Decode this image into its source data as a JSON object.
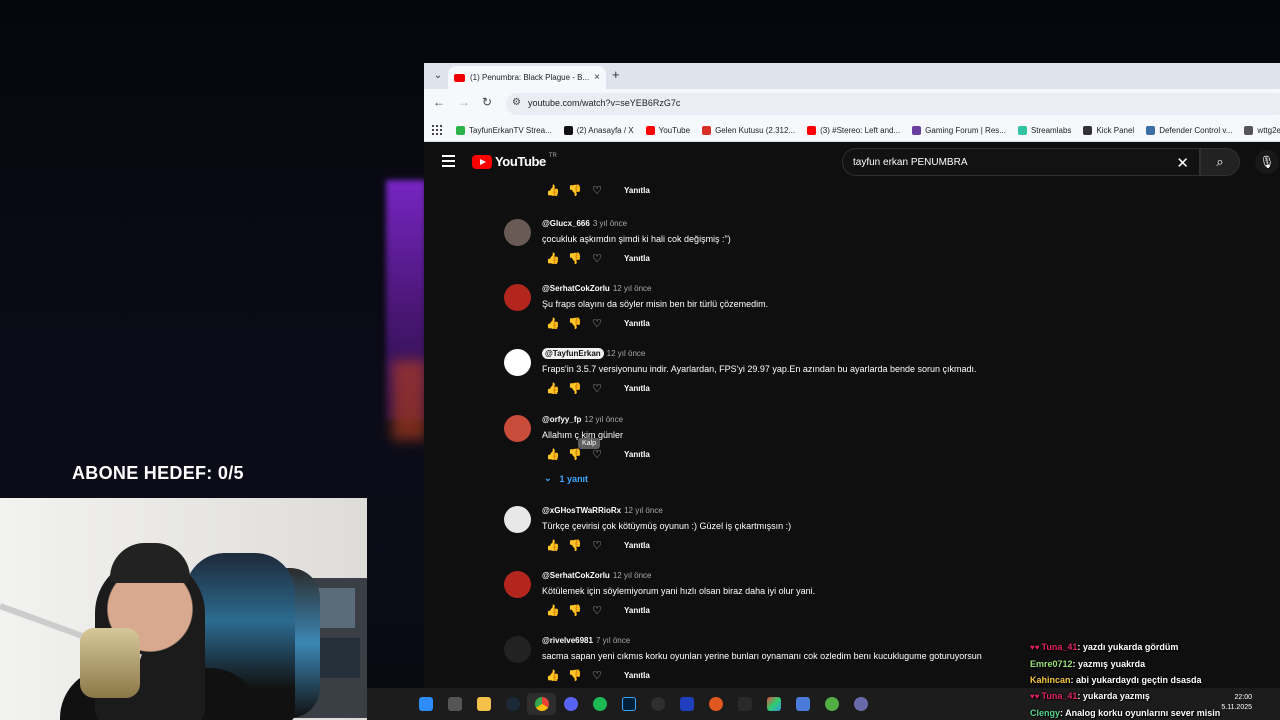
{
  "overlay": {
    "sub_goal": "ABONE HEDEF: 0/5"
  },
  "browser": {
    "tab_title": "(1) Penumbra: Black Plague - B...",
    "tab_close": "×",
    "new_tab": "+",
    "url": "youtube.com/watch?v=seYEB6RzG7c",
    "bookmarks": [
      {
        "label": "TayfunErkanTV Strea...",
        "color": "#2cb34a"
      },
      {
        "label": "(2) Anasayfa / X",
        "color": "#111111"
      },
      {
        "label": "YouTube",
        "color": "#ff0000"
      },
      {
        "label": "Gelen Kutusu (2.312...",
        "color": "#d93025"
      },
      {
        "label": "(3) #Stereo: Left and...",
        "color": "#ff0000"
      },
      {
        "label": "Gaming Forum | Res...",
        "color": "#6b3fa0"
      },
      {
        "label": "Streamlabs",
        "color": "#31c3a2"
      },
      {
        "label": "Kick Panel",
        "color": "#333333"
      },
      {
        "label": "Defender Control v...",
        "color": "#3a6ea5"
      },
      {
        "label": "wttg2e",
        "color": "#555555"
      }
    ]
  },
  "youtube": {
    "logo_text": "YouTube",
    "region": "TR",
    "search_query": "tayfun erkan PENUMBRA",
    "reply_label": "Yanıtla",
    "comments": [
      {
        "handle": "@Glucx_666",
        "time": "3 yıl önce",
        "text": "çocukluk aşkımdın şimdi ki hali cok değişmiş :\")",
        "avatar_color": "#6a5a55"
      },
      {
        "handle": "@SerhatCokZorlu",
        "time": "12 yıl önce",
        "text": "Şu fraps olayını da söyler misin ben bir türlü çözemedim.",
        "avatar_color": "#b3261e"
      },
      {
        "handle": "@TayfunErkan",
        "time": "12 yıl önce",
        "text": "Fraps'in 3.5.7 versiyonunu indir. Ayarlardan, FPS'yi 29.97 yap.En azından bu ayarlarda bende sorun çıkmadı.",
        "avatar_color": "#ffffff"
      },
      {
        "handle": "@orfyy_fp",
        "time": "12 yıl önce",
        "text": "Allahım ç      kim günler",
        "avatar_color": "#c94b3a"
      },
      {
        "handle": "@xGHosTWaRRioRx",
        "time": "12 yıl önce",
        "text": "Türkçe çevirisi çok kötüymüş oyunun :) Güzel iş çıkartmışsın :)",
        "avatar_color": "#e8e8e8"
      },
      {
        "handle": "@SerhatCokZorlu",
        "time": "12 yıl önce",
        "text": "Kötülemek için söylemiyorum yani hızlı olsan biraz daha iyi olur yani.",
        "avatar_color": "#b3261e"
      },
      {
        "handle": "@rivelve6981",
        "time": "7 yıl önce",
        "text": "sacma sapan yeni cıkmıs korku oyunları yerine bunları oynamanı cok ozledim benı kucuklugume goturuyorsun",
        "avatar_color": "#222222"
      }
    ],
    "tooltip": "Kalp",
    "replies_toggle": "1 yanıt"
  },
  "taskbar": {
    "time": "22:00",
    "date": "5.11.2025"
  },
  "chat": [
    {
      "user": "Tuna_41",
      "user_color": "#e0245e",
      "message": ": yazdı yukarda gördüm",
      "badges": "♥♥"
    },
    {
      "user": "Emre0712",
      "user_color": "#9be07a",
      "message": ": yazmış yuakrda",
      "badges": ""
    },
    {
      "user": "Kahincan",
      "user_color": "#f6c744",
      "message": ": abi yukardaydı geçtin dsasda",
      "badges": ""
    },
    {
      "user": "Tuna_41",
      "user_color": "#e0245e",
      "message": ": yukarda yazmış",
      "badges": "♥♥"
    },
    {
      "user": "Clengy",
      "user_color": "#58d68d",
      "message": ": Analog korku oyunlarını sever misin",
      "badges": ""
    }
  ]
}
